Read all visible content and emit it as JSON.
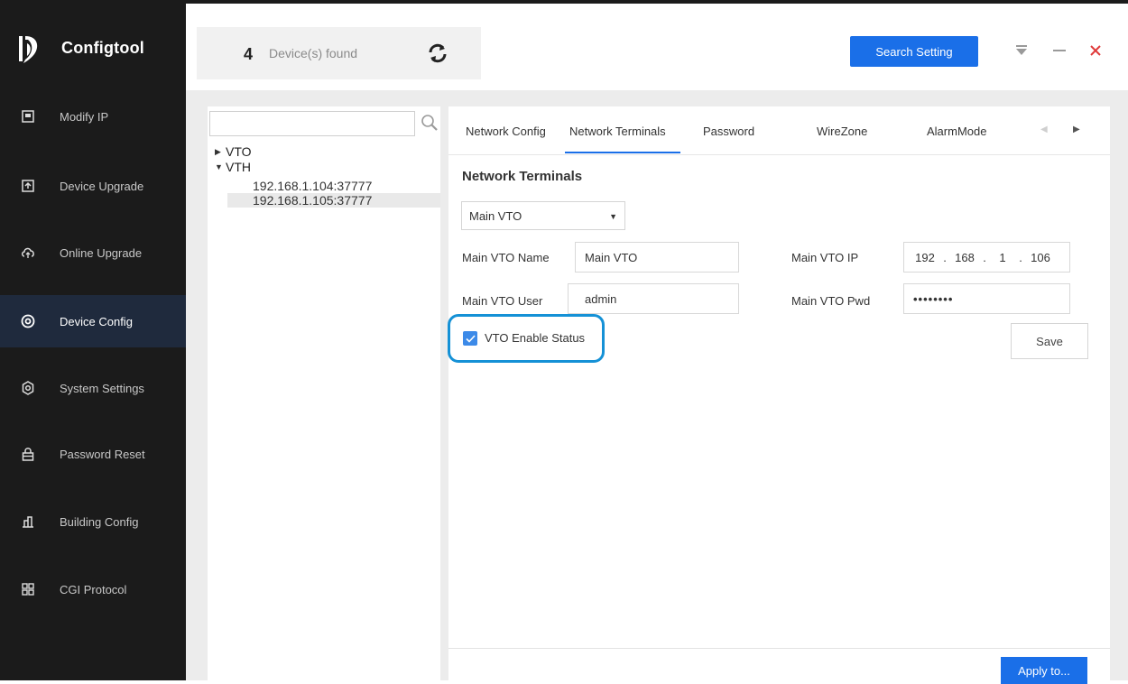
{
  "app": {
    "title": "Configtool",
    "logo_icon": "dahua-logo-icon"
  },
  "sidebar": {
    "items": [
      {
        "label": "Modify IP",
        "icon": "modify-ip-icon",
        "active": false
      },
      {
        "label": "Device Upgrade",
        "icon": "device-upgrade-icon",
        "active": false
      },
      {
        "label": "Online Upgrade",
        "icon": "cloud-upgrade-icon",
        "active": false
      },
      {
        "label": "Device Config",
        "icon": "device-config-icon",
        "active": true
      },
      {
        "label": "System Settings",
        "icon": "settings-icon",
        "active": false
      },
      {
        "label": "Password Reset",
        "icon": "lock-icon",
        "active": false
      },
      {
        "label": "Building Config",
        "icon": "building-icon",
        "active": false
      },
      {
        "label": "CGI Protocol",
        "icon": "grid-icon",
        "active": false
      }
    ]
  },
  "header": {
    "device_count": "4",
    "device_found_text": "Device(s) found",
    "search_setting_label": "Search Setting"
  },
  "device_tree": {
    "search_placeholder": "",
    "nodes": [
      {
        "label": "VTO",
        "expanded": false
      },
      {
        "label": "VTH",
        "expanded": true,
        "children": [
          "192.168.1.104:37777",
          "192.168.1.105:37777"
        ]
      }
    ]
  },
  "tabs": [
    {
      "label": "Network Config",
      "active": false
    },
    {
      "label": "Network Terminals",
      "active": true
    },
    {
      "label": "Password",
      "active": false
    },
    {
      "label": "WireZone",
      "active": false
    },
    {
      "label": "AlarmMode",
      "active": false
    }
  ],
  "network_terminals": {
    "section_title": "Network Terminals",
    "selected_terminal": "Main VTO",
    "name_label": "Main VTO Name",
    "name_value": "Main VTO",
    "ip_label": "Main VTO IP",
    "ip_octets": [
      "192",
      "168",
      "1",
      "106"
    ],
    "user_label": "Main VTO User",
    "user_value": "admin",
    "pwd_label": "Main VTO Pwd",
    "pwd_value": "••••••••",
    "enable_status_label": "VTO Enable Status",
    "enable_status_checked": true,
    "save_label": "Save",
    "apply_label": "Apply to..."
  },
  "colors": {
    "sidebar_bg": "#1b1b1b",
    "active_nav_bg": "#1f2a3d",
    "accent_blue": "#1a6fe8",
    "close_red": "#e03a3a",
    "highlight_ring": "#1591d6"
  }
}
